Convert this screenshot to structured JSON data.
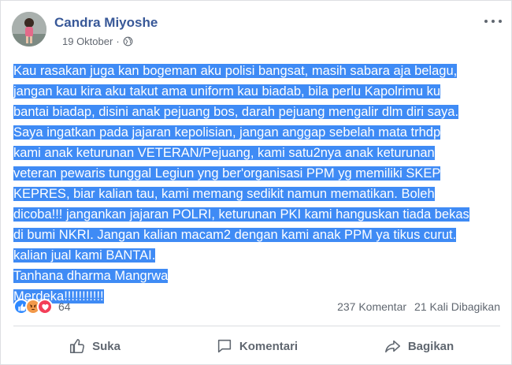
{
  "post": {
    "author": "Candra Miyoshe",
    "date": "19 Oktober",
    "separator": "·",
    "privacy_icon": "globe-icon",
    "more_icon": "more-options-icon",
    "text_lines": [
      "Kau rasakan juga kan bogeman aku polisi bangsat, masih sabara aja belagu,",
      "jangan kau kira aku takut ama uniform kau biadab, bila perlu Kapolrimu ku",
      "bantai biadap, disini anak pejuang bos, darah pejuang mengalir dlm diri saya.",
      "Saya ingatkan pada jajaran kepolisian, jangan anggap sebelah mata trhdp",
      "kami anak keturunan VETERAN/Pejuang, kami satu2nya anak keturunan",
      "veteran pewaris tunggal Legiun yng ber'organisasi PPM yg memiliki SKEP",
      "KEPRES, biar kalian tau, kami memang sedikit namun mematikan. Boleh",
      "dicoba!!! jangankan jajaran POLRI, keturunan PKI kami hanguskan tiada bekas",
      "di bumi NKRI. Jangan kalian macam2 dengan kami anak PPM ya tikus curut.",
      "kalian jual kami BANTAI. ",
      "Tanhana dharma Mangrwa",
      "Merdeka!!!!!!!!!!!"
    ],
    "highlight_color": "#3f8bf5"
  },
  "stats": {
    "reaction_icons": [
      "like-icon",
      "angry-icon",
      "love-icon"
    ],
    "reaction_count": "64",
    "comments": "237 Komentar",
    "shares": "21 Kali Dibagikan"
  },
  "actions": {
    "like_label": "Suka",
    "comment_label": "Komentari",
    "share_label": "Bagikan"
  }
}
